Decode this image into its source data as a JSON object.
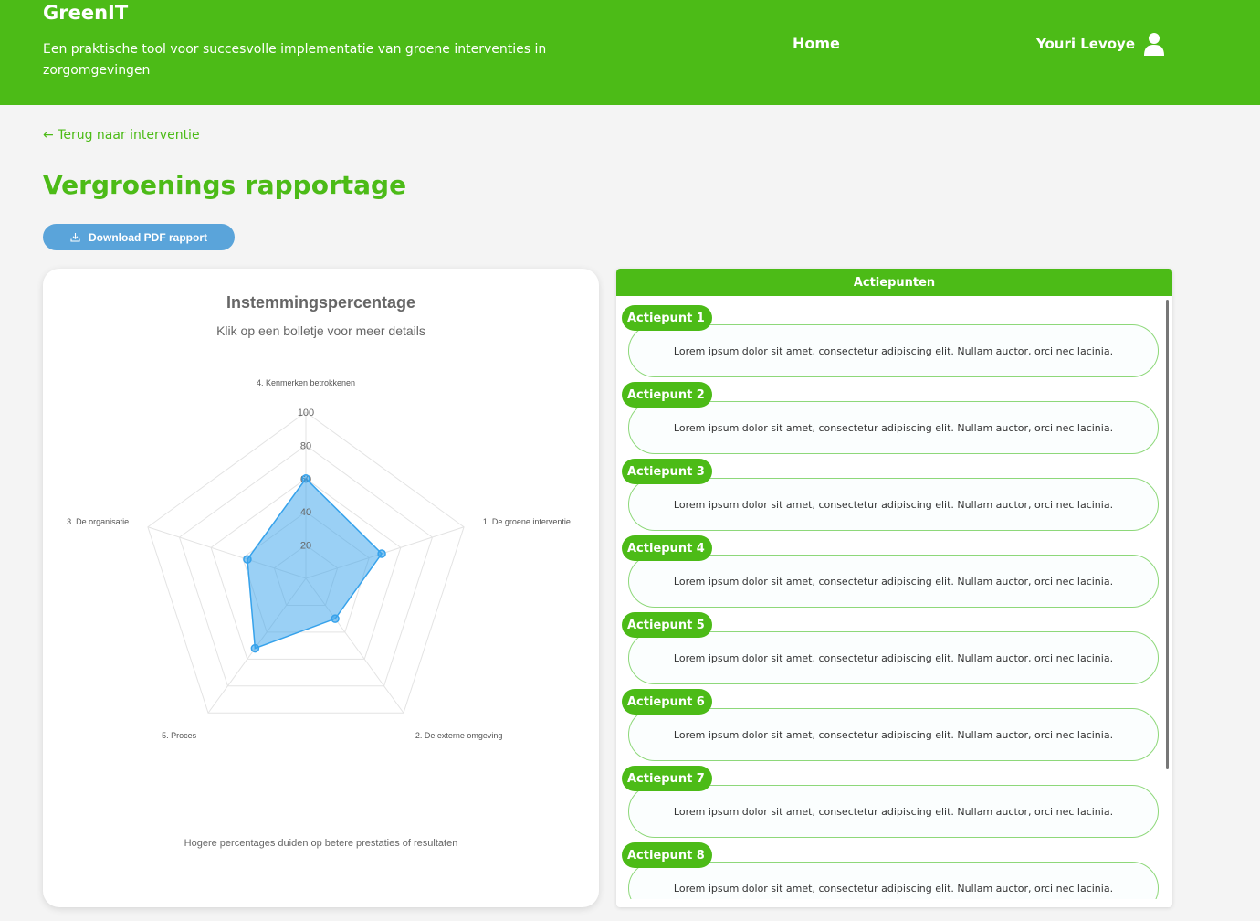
{
  "header": {
    "brand": "GreenIT",
    "tagline": "Een praktische tool voor succesvolle implementatie van groene interventies in zorgomgevingen",
    "nav_home": "Home",
    "user_name": "Youri Levoye"
  },
  "back_link": "← Terug naar interventie",
  "page_title": "Vergroenings rapportage",
  "download_button": "Download PDF rapport",
  "chart_footnote": "Hogere percentages duiden op betere prestaties of resultaten",
  "colors": {
    "brand_green": "#4cbb17",
    "button_blue": "#5aa4da",
    "series_fill": "#36a2eb"
  },
  "chart_data": {
    "type": "radar",
    "title": "Instemmingspercentage",
    "subtitle": "Klik op een bolletje voor meer details",
    "categories": [
      "1. De groene interventie",
      "2. De externe omgeving",
      "5. Proces",
      "3. De organisatie",
      "4. Kenmerken betrokkenen"
    ],
    "axis_order": [
      "4. Kenmerken betrokkenen",
      "1. De groene interventie",
      "2. De externe omgeving",
      "5. Proces",
      "3. De organisatie"
    ],
    "series": [
      {
        "values": [
          48,
          30,
          52,
          37,
          60
        ]
      }
    ],
    "range": [
      0,
      100
    ],
    "ticks": [
      20,
      40,
      60,
      80,
      100
    ],
    "grid": true,
    "legend": false
  },
  "actiepunten": {
    "header": "Actiepunten",
    "items": [
      {
        "label": "Actiepunt 1",
        "text": "Lorem ipsum dolor sit amet, consectetur adipiscing elit. Nullam auctor, orci nec lacinia."
      },
      {
        "label": "Actiepunt 2",
        "text": "Lorem ipsum dolor sit amet, consectetur adipiscing elit. Nullam auctor, orci nec lacinia."
      },
      {
        "label": "Actiepunt 3",
        "text": "Lorem ipsum dolor sit amet, consectetur adipiscing elit. Nullam auctor, orci nec lacinia."
      },
      {
        "label": "Actiepunt 4",
        "text": "Lorem ipsum dolor sit amet, consectetur adipiscing elit. Nullam auctor, orci nec lacinia."
      },
      {
        "label": "Actiepunt 5",
        "text": "Lorem ipsum dolor sit amet, consectetur adipiscing elit. Nullam auctor, orci nec lacinia."
      },
      {
        "label": "Actiepunt 6",
        "text": "Lorem ipsum dolor sit amet, consectetur adipiscing elit. Nullam auctor, orci nec lacinia."
      },
      {
        "label": "Actiepunt 7",
        "text": "Lorem ipsum dolor sit amet, consectetur adipiscing elit. Nullam auctor, orci nec lacinia."
      },
      {
        "label": "Actiepunt 8",
        "text": "Lorem ipsum dolor sit amet, consectetur adipiscing elit. Nullam auctor, orci nec lacinia."
      }
    ]
  }
}
